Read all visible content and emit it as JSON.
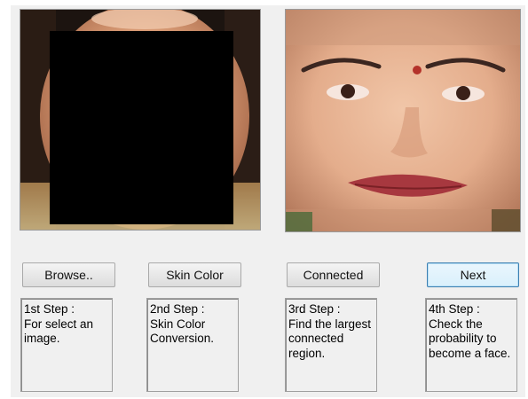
{
  "buttons": {
    "browse": "Browse..",
    "skin_color": "Skin Color",
    "connected": "Connected",
    "next": "Next"
  },
  "steps": [
    "1st Step :\nFor select an image.",
    "2nd Step :\nSkin Color Conversion.",
    "3rd Step :\nFind the largest connected region.",
    "4th Step :\nCheck the probability to become a face."
  ],
  "colors": {
    "window_background": "#f0f0f0",
    "focused_button_border": "#3c7fb1",
    "redaction_box": "#000000"
  }
}
